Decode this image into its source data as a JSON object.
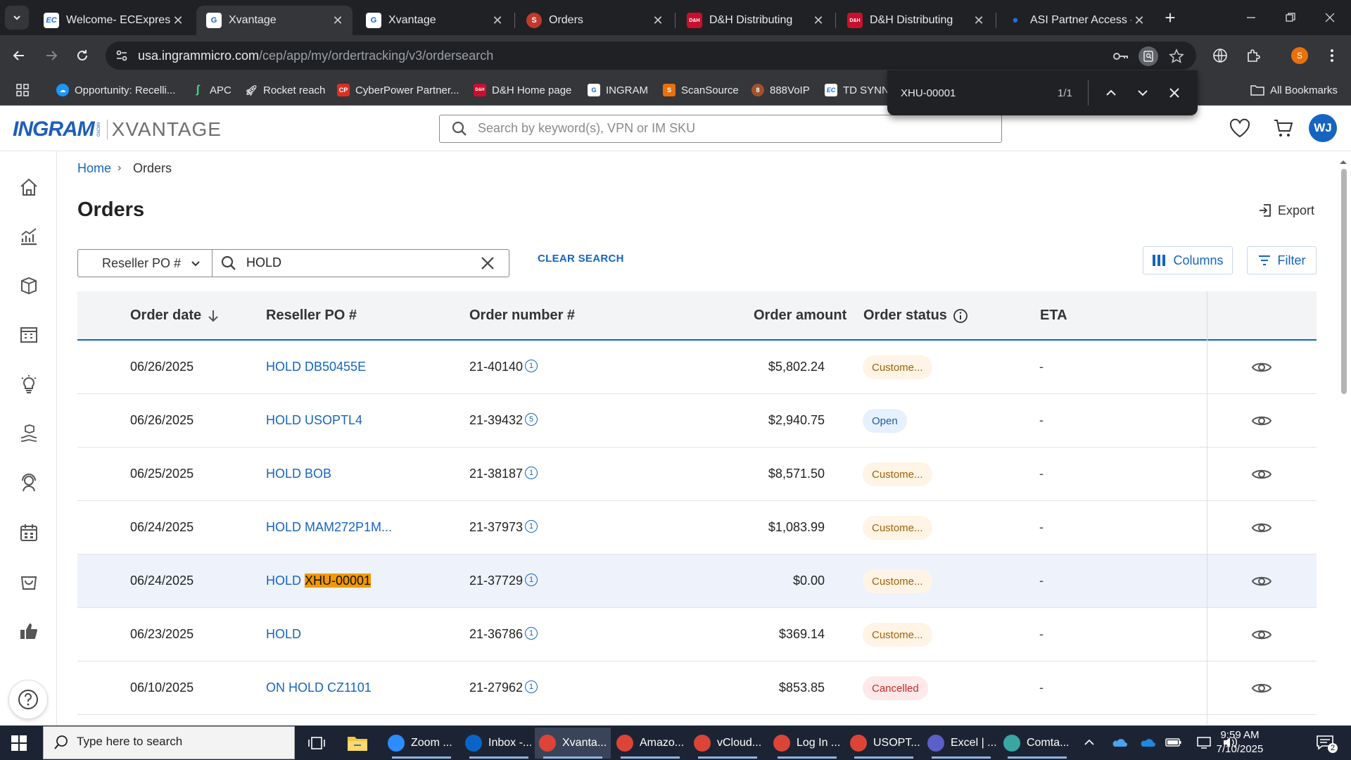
{
  "browser": {
    "tabs": [
      {
        "title": "Welcome- ECExpress",
        "favicon": "EC",
        "favicon_color": "#1a73e8",
        "active": false
      },
      {
        "title": "Xvantage",
        "favicon": "G",
        "favicon_color": "#1565c0",
        "active": true
      },
      {
        "title": "Xvantage",
        "favicon": "G",
        "favicon_color": "#1565c0",
        "active": false
      },
      {
        "title": "Orders",
        "favicon": "S",
        "favicon_color": "#c0392b",
        "active": false
      },
      {
        "title": "D&H Distributing",
        "favicon": "D&H",
        "favicon_color": "#c8102e",
        "active": false
      },
      {
        "title": "D&H Distributing",
        "favicon": "D&H",
        "favicon_color": "#c8102e",
        "active": false
      },
      {
        "title": "ASI Partner Access - I",
        "favicon": "•",
        "favicon_color": "#1a73e8",
        "active": false
      }
    ],
    "url_host": "usa.ingrammicro.com",
    "url_path": "/cep/app/my/ordertracking/v3/ordersearch",
    "profile_initial": "S",
    "bookmarks": [
      {
        "label": "Opportunity: Recelli...",
        "icon": "cloud-icon",
        "color": "#1b96ff"
      },
      {
        "label": "APC",
        "icon": "apc-icon",
        "color": "#3ddc84"
      },
      {
        "label": "Rocket reach",
        "icon": "rocket-icon",
        "color": "#e8eaed"
      },
      {
        "label": "CyberPower Partner...",
        "icon": "cp-icon",
        "color": "#d93025"
      },
      {
        "label": "D&H Home page",
        "icon": "dh-icon",
        "color": "#c8102e"
      },
      {
        "label": "INGRAM",
        "icon": "ingram-icon",
        "color": "#1565c0"
      },
      {
        "label": "ScanSource",
        "icon": "scansource-icon",
        "color": "#e8710a"
      },
      {
        "label": "888VoIP",
        "icon": "voip-icon",
        "color": "#a0522d"
      },
      {
        "label": "TD SYNN",
        "icon": "ec-icon",
        "color": "#1a73e8"
      }
    ],
    "all_bookmarks": "All Bookmarks",
    "find": {
      "query": "XHU-00001",
      "count": "1/1"
    }
  },
  "app": {
    "logo_primary": "INGRAM",
    "logo_micro": "MICRO",
    "logo_secondary": "XVANTAGE",
    "search_placeholder": "Search by keyword(s), VPN or IM SKU",
    "user_initials": "WJ"
  },
  "page": {
    "breadcrumb": {
      "home": "Home",
      "current": "Orders"
    },
    "title": "Orders",
    "export_label": "Export",
    "filter_field": "Reseller PO #",
    "filter_value": "HOLD",
    "clear_search": "CLEAR SEARCH",
    "columns_label": "Columns",
    "filter_label": "Filter"
  },
  "table": {
    "headers": {
      "order_date": "Order date",
      "reseller_po": "Reseller PO #",
      "order_number": "Order number #",
      "order_amount": "Order amount",
      "order_status": "Order status",
      "eta": "ETA"
    },
    "rows": [
      {
        "date": "06/26/2025",
        "po": "HOLD DB50455E",
        "po_match": "",
        "order": "21-40140",
        "badge": "1",
        "amount": "$5,802.24",
        "status": "Custome...",
        "status_type": "cust",
        "eta": "-"
      },
      {
        "date": "06/26/2025",
        "po": "HOLD USOPTL4",
        "po_match": "",
        "order": "21-39432",
        "badge": "5",
        "amount": "$2,940.75",
        "status": "Open",
        "status_type": "open",
        "eta": "-"
      },
      {
        "date": "06/25/2025",
        "po": "HOLD BOB",
        "po_match": "",
        "order": "21-38187",
        "badge": "1",
        "amount": "$8,571.50",
        "status": "Custome...",
        "status_type": "cust",
        "eta": "-"
      },
      {
        "date": "06/24/2025",
        "po": "HOLD MAM272P1M...",
        "po_match": "",
        "order": "21-37973",
        "badge": "1",
        "amount": "$1,083.99",
        "status": "Custome...",
        "status_type": "cust",
        "eta": "-"
      },
      {
        "date": "06/24/2025",
        "po": "HOLD ",
        "po_match": "XHU-00001",
        "order": "21-37729",
        "badge": "1",
        "amount": "$0.00",
        "status": "Custome...",
        "status_type": "cust",
        "eta": "-"
      },
      {
        "date": "06/23/2025",
        "po": "HOLD",
        "po_match": "",
        "order": "21-36786",
        "badge": "1",
        "amount": "$369.14",
        "status": "Custome...",
        "status_type": "cust",
        "eta": "-"
      },
      {
        "date": "06/10/2025",
        "po": "ON HOLD CZ1101",
        "po_match": "",
        "order": "21-27962",
        "badge": "1",
        "amount": "$853.85",
        "status": "Cancelled",
        "status_type": "cancel",
        "eta": "-"
      }
    ]
  },
  "taskbar": {
    "search_placeholder": "Type here to search",
    "apps": [
      {
        "label": "Zoom ...",
        "icon": "zoom-icon",
        "color": "#2d8cff",
        "active": false
      },
      {
        "label": "Inbox -...",
        "icon": "outlook-icon",
        "color": "#0a64c8",
        "active": false
      },
      {
        "label": "Xvanta...",
        "icon": "chrome-icon",
        "color": "#db4437",
        "active": true
      },
      {
        "label": "Amazo...",
        "icon": "chrome-icon",
        "color": "#db4437",
        "active": false
      },
      {
        "label": "vCloud...",
        "icon": "chrome-icon",
        "color": "#db4437",
        "active": false
      },
      {
        "label": "Log In ...",
        "icon": "chrome-icon",
        "color": "#db4437",
        "active": false
      },
      {
        "label": "USOPT...",
        "icon": "chrome-icon",
        "color": "#db4437",
        "active": false
      },
      {
        "label": "Excel | ...",
        "icon": "teams-icon",
        "color": "#5b5fc7",
        "active": false
      },
      {
        "label": "Comta...",
        "icon": "comtrade-icon",
        "color": "#3aa6a2",
        "active": false
      }
    ],
    "time": "9:59 AM",
    "date": "7/10/2025",
    "notification_count": "2"
  }
}
